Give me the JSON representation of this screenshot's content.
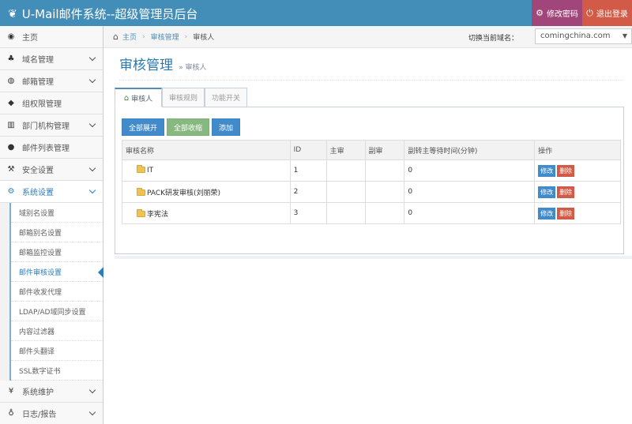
{
  "app": {
    "title": "U-Mail邮件系统--超级管理员后台"
  },
  "topbar": {
    "change_password": "修改密码",
    "logout": "退出登录"
  },
  "sidebar": {
    "items": [
      {
        "label": "主页",
        "icon": "dashboard-icon",
        "has_children": false
      },
      {
        "label": "域名管理",
        "icon": "sitemap-icon",
        "has_children": true
      },
      {
        "label": "邮箱管理",
        "icon": "globe-icon",
        "has_children": true
      },
      {
        "label": "组权限管理",
        "icon": "tags-icon",
        "has_children": false
      },
      {
        "label": "部门机构管理",
        "icon": "bar-chart-icon",
        "has_children": true
      },
      {
        "label": "邮件列表管理",
        "icon": "user-icon",
        "has_children": false
      },
      {
        "label": "安全设置",
        "icon": "gavel-icon",
        "has_children": true
      },
      {
        "label": "系统设置",
        "icon": "cog-icon",
        "has_children": true,
        "active": true
      }
    ],
    "subitems": [
      "域别名设置",
      "邮箱别名设置",
      "邮箱监控设置",
      "邮件审核设置",
      "邮件收发代理",
      "LDAP/AD域同步设置",
      "内容过滤器",
      "邮件头翻译",
      "SSL数字证书"
    ],
    "current_subitem": 3,
    "bottom_items": [
      {
        "label": "系统维护",
        "icon": "yen-icon"
      },
      {
        "label": "日志/报告",
        "icon": "lightbulb-icon"
      }
    ]
  },
  "breadcrumb": {
    "home": "主页",
    "section": "审核管理",
    "current": "审核人"
  },
  "domain": {
    "label": "切换当前域名：",
    "value": "comingchina.com"
  },
  "page": {
    "title": "审核管理",
    "subtitle": "» 审核人"
  },
  "tabs": [
    "审核人",
    "审核规则",
    "功能开关"
  ],
  "buttons": {
    "expand_all": "全部展开",
    "collapse_all": "全部收缩",
    "add": "添加"
  },
  "table": {
    "headers": [
      "审核名称",
      "ID",
      "主审",
      "副审",
      "副转主等待时间(分钟)",
      "操作"
    ],
    "rows": [
      {
        "name": "IT",
        "id": "1",
        "main": "",
        "sub": "",
        "wait": "0"
      },
      {
        "name": "PACK研发审核(刘丽荣)",
        "id": "2",
        "main": "",
        "sub": "",
        "wait": "0"
      },
      {
        "name": "李宪法",
        "id": "3",
        "main": "",
        "sub": "",
        "wait": "0"
      }
    ],
    "edit_label": "修改",
    "delete_label": "删除"
  },
  "colors": {
    "topbar": "#438eb9",
    "accent": "#2b7dbc",
    "password_btn": "#a0467a",
    "logout_btn": "#d15b47"
  }
}
